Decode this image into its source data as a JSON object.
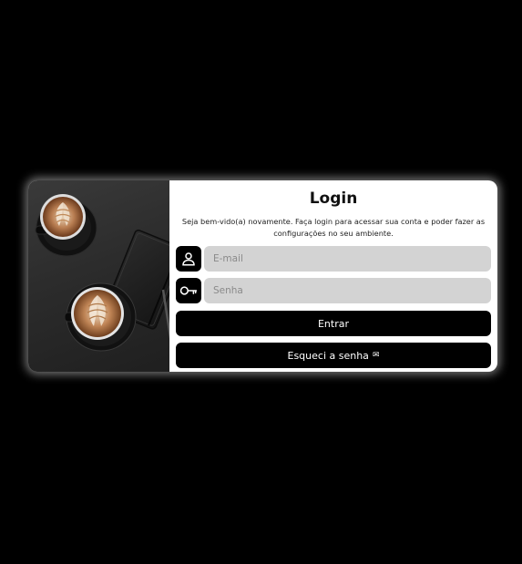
{
  "login": {
    "title": "Login",
    "subtitle": "Seja bem-vido(a) novamente. Faça login para acessar sua conta e poder fazer as configurações no seu ambiente.",
    "email": {
      "placeholder": "E-mail",
      "value": "",
      "icon": "user-icon"
    },
    "password": {
      "placeholder": "Senha",
      "value": "",
      "icon": "key-icon"
    },
    "submit_label": "Entrar",
    "forgot_label": "Esqueci a senha",
    "forgot_icon": "✉"
  },
  "colors": {
    "page_background": "#000000",
    "card_background": "#ffffff",
    "button_background": "#000000",
    "button_text": "#ffffff",
    "input_background": "#d3d3d3"
  }
}
